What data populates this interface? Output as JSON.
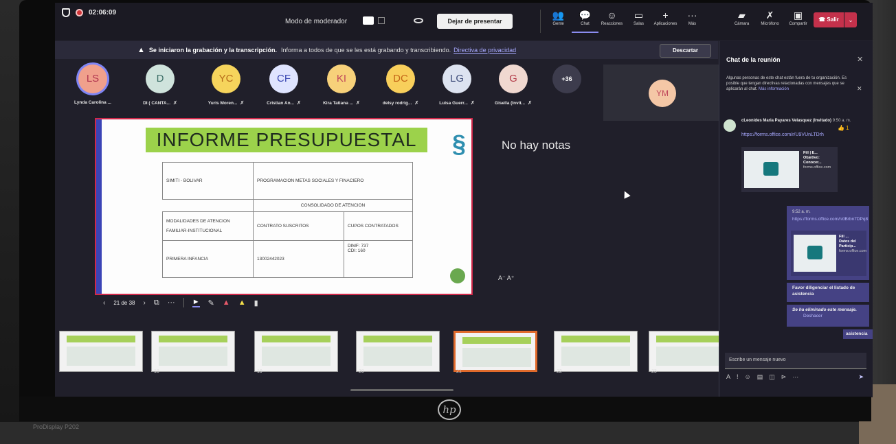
{
  "topbar": {
    "timer": "02:06:09",
    "moderator_label": "Modo de moderador",
    "stop_presenting": "Dejar de presentar",
    "actions": [
      {
        "label": "Gente",
        "icon": "people-icon",
        "glyph": "👥"
      },
      {
        "label": "Chat",
        "icon": "chat-icon",
        "glyph": "💬",
        "active": true
      },
      {
        "label": "Reacciones",
        "icon": "reactions-icon",
        "glyph": "☺"
      },
      {
        "label": "Salas",
        "icon": "rooms-icon",
        "glyph": "▭"
      },
      {
        "label": "Aplicaciones",
        "icon": "apps-icon",
        "glyph": "+"
      },
      {
        "label": "Más",
        "icon": "more-icon",
        "glyph": "···"
      }
    ],
    "media": [
      {
        "label": "Cámara",
        "icon": "camera-off-icon",
        "glyph": "▰"
      },
      {
        "label": "Micrófono",
        "icon": "mic-off-icon",
        "glyph": "✗"
      },
      {
        "label": "Compartir",
        "icon": "share-icon",
        "glyph": "▣"
      }
    ],
    "leave": "Salir"
  },
  "banner": {
    "bold": "Se iniciaron la grabación y la transcripción.",
    "text": "Informa a todos de que se les está grabando y transcribiendo.",
    "link": "Directiva de privacidad",
    "dismiss": "Descartar"
  },
  "participants": [
    {
      "initials": "LS",
      "name": "Lynda Carolina ...",
      "bg": "#f0a08c",
      "fg": "#b0344f",
      "ring": "#7f85f5"
    },
    {
      "initials": "D",
      "name": "DI ( CANTA...",
      "bg": "#cfe3dc",
      "fg": "#3c6e67"
    },
    {
      "initials": "YC",
      "name": "Yuris Moren...",
      "bg": "#f6d45c",
      "fg": "#b46a1a"
    },
    {
      "initials": "CF",
      "name": "Cristian An...",
      "bg": "#dfe4ff",
      "fg": "#3a47b2"
    },
    {
      "initials": "KI",
      "name": "Kira Tatiana ...",
      "bg": "#f7d17a",
      "fg": "#c0475b"
    },
    {
      "initials": "DC",
      "name": "delsy rodrig...",
      "bg": "#f8cf5b",
      "fg": "#c46617"
    },
    {
      "initials": "LG",
      "name": "Luisa Guerr...",
      "bg": "#dde3f0",
      "fg": "#3f4d7a"
    },
    {
      "initials": "G",
      "name": "Gisella (Invit...",
      "bg": "#f0d8d0",
      "fg": "#b33d4a"
    }
  ],
  "participants_overflow": "+36",
  "video_tile": {
    "initials": "YM"
  },
  "slide": {
    "title": "INFORME PRESUPUESTAL",
    "table": {
      "r1c1": "SIMITI  -  BOLIVAR",
      "r1c2": "PROGRAMACION METAS SOCIALES Y FINACIERO",
      "r2": "CONSOLIDADO DE ATENCION",
      "r3c1": "MODALIDADES DE ATENCION\n\nFAMILIAR-INSTITUCIONAL",
      "r3c2": "CONTRATO SUSCRITOS",
      "r3c3": "CUPOS CONTRATADOS",
      "r4c1": "PRIMERA INFANCIA",
      "r4c2": "13002442023",
      "r4c3": "DIMF: 737\nCDI: 160"
    }
  },
  "slide_nav": {
    "counter": "21 de 38"
  },
  "notes": {
    "empty": "No hay notas",
    "font_ctrl": "A⁻  A⁺"
  },
  "filmstrip": {
    "thumbs": [
      {
        "num": "",
        "current": false
      },
      {
        "num": "18",
        "current": false
      },
      {
        "num": "19",
        "current": false
      },
      {
        "num": "20",
        "current": false
      },
      {
        "num": "21",
        "current": true
      },
      {
        "num": "22",
        "current": false
      },
      {
        "num": "23",
        "current": false
      }
    ]
  },
  "chat": {
    "title": "Chat de la reunión",
    "notice": "Algunas personas de este chat están fuera de tu organización. Es posible que tengan directivas relacionadas con mensajes que se aplicarán al chat.",
    "notice_link": "Más información",
    "msg1": {
      "author": "cLeonides Maria Payares Velasquez (Invitado)",
      "time": "9:50 a. m.",
      "reaction": "👍 1",
      "link": "https://forms.office.com/r/U9VUnLTDrh",
      "card_title": "Fill | E...",
      "card_desc": "Objetivo: Conocer...",
      "card_domain": "forms.office.com"
    },
    "msg2": {
      "time": "9:52 a. m.",
      "link": "https://forms.office.com/r/dBrbn7DPq8",
      "card_title": "Fill ...",
      "card_desc": "Datos del Particip...",
      "card_domain": "forms.office.com"
    },
    "msg3": "Favor diligenciar el listado de asistencia",
    "msg4_deleted": "Se ha eliminado este mensaje.",
    "msg4_undo": "Deshacer",
    "msg5": "asistencia",
    "compose_placeholder": "Escribe un mensaje nuevo"
  },
  "monitor": {
    "brand": "hp",
    "label": "ProDisplay P202"
  }
}
